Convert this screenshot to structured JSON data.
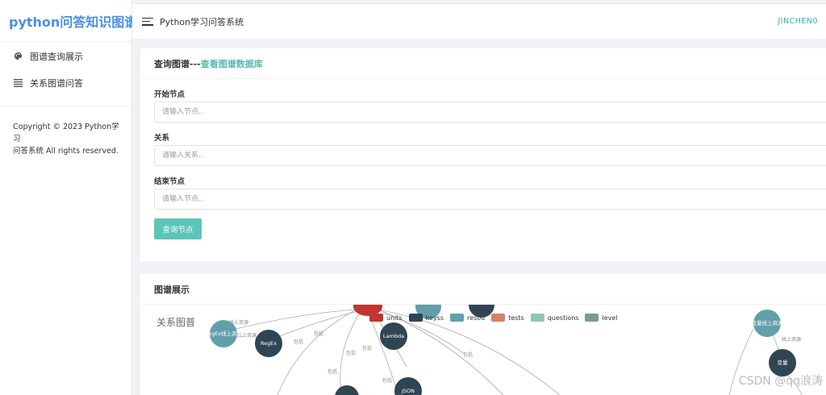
{
  "sidebar": {
    "brand": "python问答知识图谱",
    "items": [
      {
        "label": "图谱查询展示",
        "icon": "palette-icon"
      },
      {
        "label": "关系图谱问答",
        "icon": "list-icon"
      }
    ],
    "copyright_line1": "Copyright © 2023 Python学习",
    "copyright_line2": "问答系统 All rights reserved."
  },
  "topbar": {
    "title": "Python学习问答系统",
    "user": "JINCHEN0"
  },
  "query_card": {
    "title": "查询图谱---",
    "link": "查看图谱数据库",
    "start_label": "开始节点",
    "start_placeholder": "请输入节点..",
    "relation_label": "关系",
    "relation_placeholder": "请输入关系..",
    "end_label": "结束节点",
    "end_placeholder": "请输入节点..",
    "button": "查询节点"
  },
  "graph_card": {
    "title": "图谱展示",
    "graph_label": "关系图普",
    "legend": [
      {
        "name": "units",
        "color": "#c23531"
      },
      {
        "name": "keyss",
        "color": "#2f4554"
      },
      {
        "name": "resou",
        "color": "#61a0a8"
      },
      {
        "name": "tests",
        "color": "#d48265"
      },
      {
        "name": "questions",
        "color": "#91c7ae"
      },
      {
        "name": "level",
        "color": "#749f83"
      }
    ],
    "nodes": [
      {
        "label": "RegEx线上资源",
        "color": "#61a0a8"
      },
      {
        "label": "RegEx",
        "color": "#2f4554"
      },
      {
        "label": "Lambda",
        "color": "#2f4554"
      },
      {
        "label": "JSON",
        "color": "#2f4554"
      },
      {
        "label": "变量线上资源",
        "color": "#61a0a8"
      },
      {
        "label": "变量",
        "color": "#2f4554"
      }
    ],
    "edge_labels": {
      "resource": "线上资源",
      "include": "包括"
    }
  },
  "watermark": "CSDN @qq浪涛"
}
